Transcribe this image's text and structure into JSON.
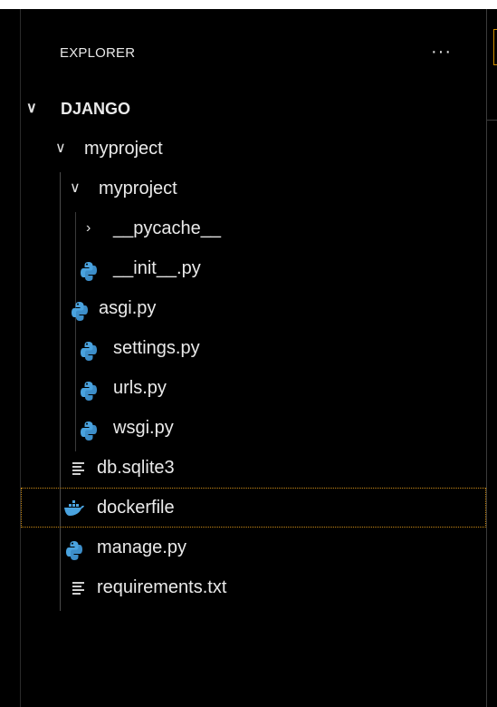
{
  "explorer": {
    "title": "EXPLORER",
    "more_label": "···"
  },
  "tree": {
    "root": "DJANGO",
    "items": [
      {
        "label": "myproject",
        "kind": "folder-open"
      },
      {
        "label": "myproject",
        "kind": "folder-open"
      },
      {
        "label": "__pycache__",
        "kind": "folder-closed"
      },
      {
        "label": "__init__.py",
        "kind": "python-file",
        "icon": "python-icon"
      },
      {
        "label": "asgi.py",
        "kind": "python-file",
        "icon": "python-icon"
      },
      {
        "label": "settings.py",
        "kind": "python-file",
        "icon": "python-icon"
      },
      {
        "label": "urls.py",
        "kind": "python-file",
        "icon": "python-icon"
      },
      {
        "label": "wsgi.py",
        "kind": "python-file",
        "icon": "python-icon"
      },
      {
        "label": "db.sqlite3",
        "kind": "text-file",
        "icon": "lines-icon"
      },
      {
        "label": "dockerfile",
        "kind": "docker-file",
        "icon": "docker-icon",
        "selected": true
      },
      {
        "label": "manage.py",
        "kind": "python-file",
        "icon": "python-icon"
      },
      {
        "label": "requirements.txt",
        "kind": "text-file",
        "icon": "lines-icon"
      }
    ]
  },
  "colors": {
    "background": "#000000",
    "python_icon": "#4aa3df",
    "docker_icon": "#4aa3df",
    "selection_outline": "#c98a17"
  }
}
